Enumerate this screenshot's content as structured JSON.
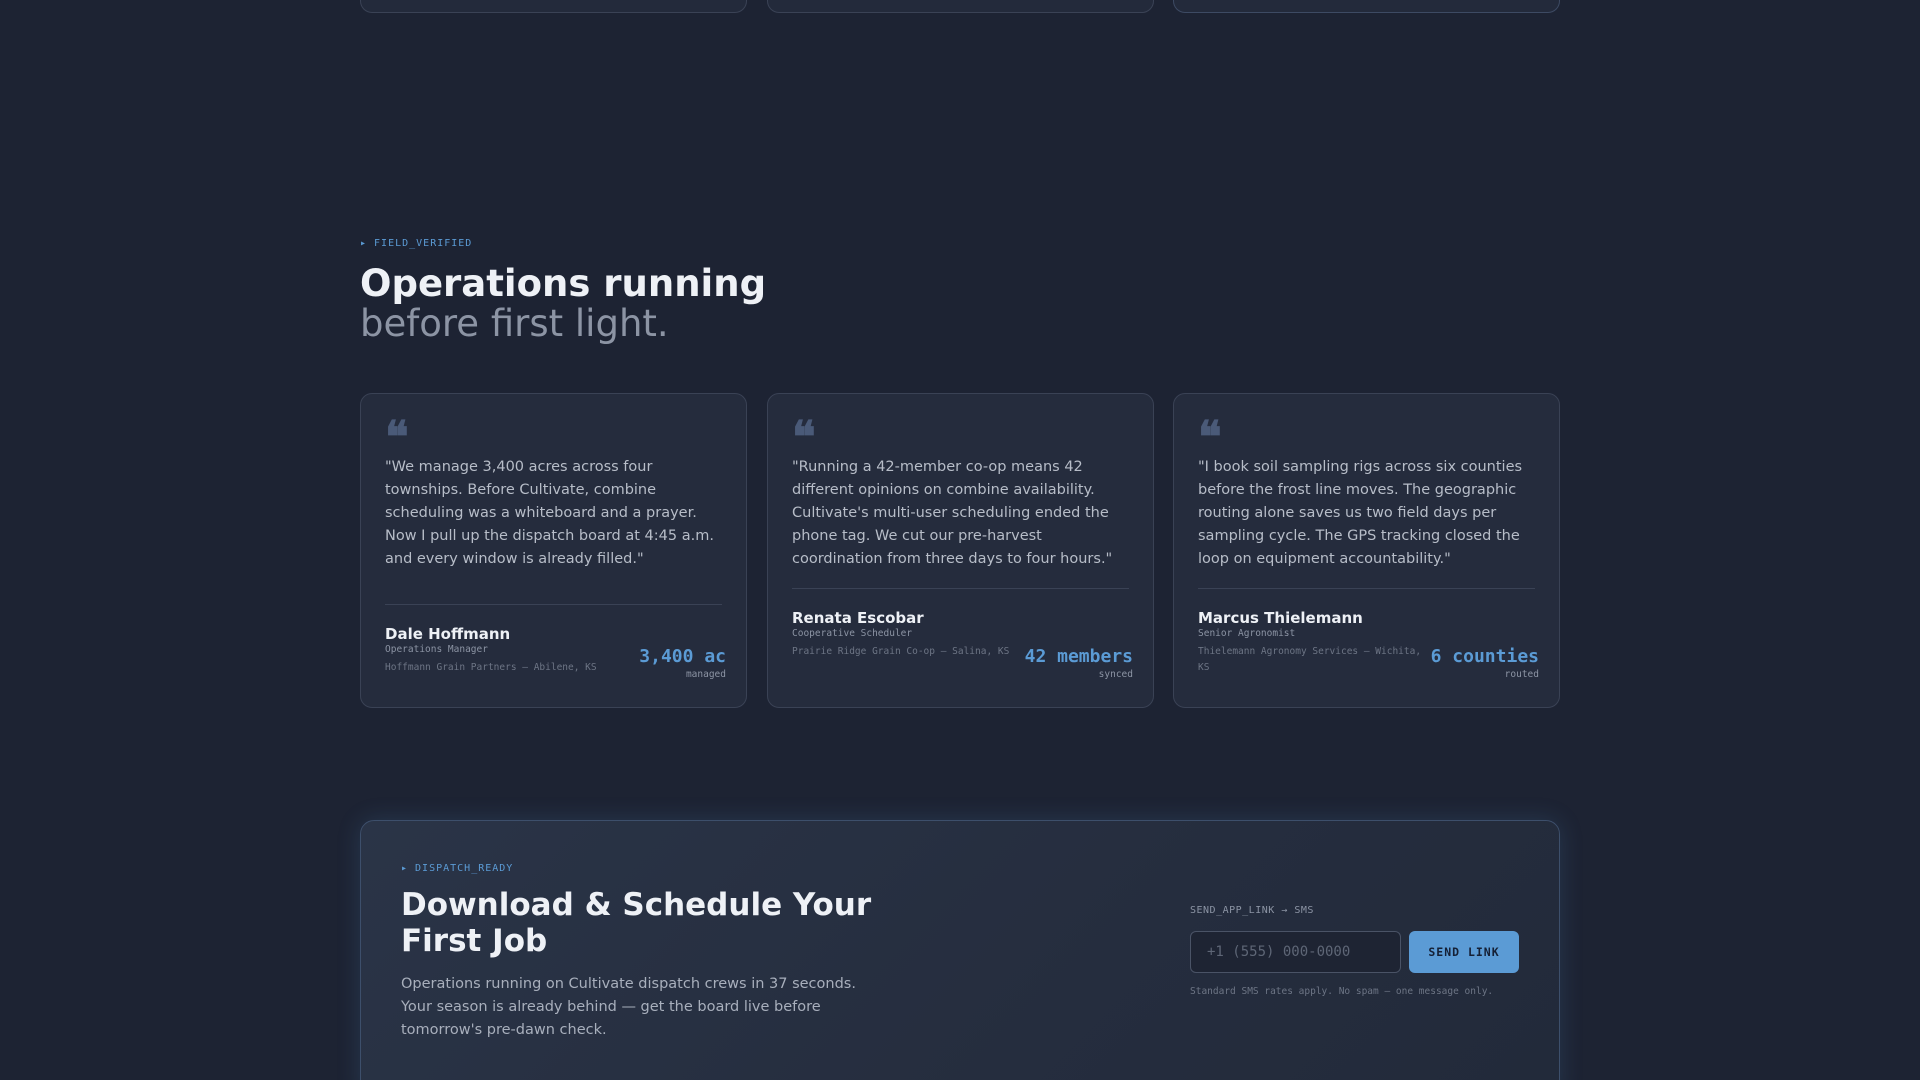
{
  "testimonials_section": {
    "tag": "▸ FIELD_VERIFIED",
    "title": "Operations running",
    "subtitle": "before first light.",
    "quote_icon": "quote-icon",
    "cards": [
      {
        "quote": "\"We manage 3,400 acres across four townships. Before Cultivate, combine scheduling was a whiteboard and a prayer. Now I pull up the dispatch board at 4:45 a.m. and every window is already filled.\"",
        "name": "Dale Hoffmann",
        "role": "Operations Manager",
        "org": "Hoffmann Grain Partners — Abilene, KS",
        "metric_value": "3,400 ac",
        "metric_label": "managed"
      },
      {
        "quote": "\"Running a 42-member co-op means 42 different opinions on combine availability. Cultivate's multi-user scheduling ended the phone tag. We cut our pre-harvest coordination from three days to four hours.\"",
        "name": "Renata Escobar",
        "role": "Cooperative Scheduler",
        "org": "Prairie Ridge Grain Co-op — Salina, KS",
        "metric_value": "42 members",
        "metric_label": "synced"
      },
      {
        "quote": "\"I book soil sampling rigs across six counties before the frost line moves. The geographic routing alone saves us two field days per sampling cycle. The GPS tracking closed the loop on equipment accountability.\"",
        "name": "Marcus Thielemann",
        "role": "Senior Agronomist",
        "org": "Thielemann Agronomy Services — Wichita, KS",
        "metric_value": "6 counties",
        "metric_label": "routed"
      }
    ]
  },
  "cta": {
    "tag": "▸ DISPATCH_READY",
    "title": "Download & Schedule Your First Job",
    "body": "Operations running on Cultivate dispatch crews in 37 seconds. Your season is already behind — get the board live before tomorrow's pre-dawn check.",
    "sms_label": "SEND_APP_LINK → SMS",
    "phone_placeholder": "+1 (555) 000-0000",
    "send_label": "SEND LINK",
    "note": "Standard SMS rates apply. No spam — one message only."
  },
  "colors": {
    "background": "#1d2333",
    "accent": "#5b9bd5",
    "card": "#252c3d"
  }
}
